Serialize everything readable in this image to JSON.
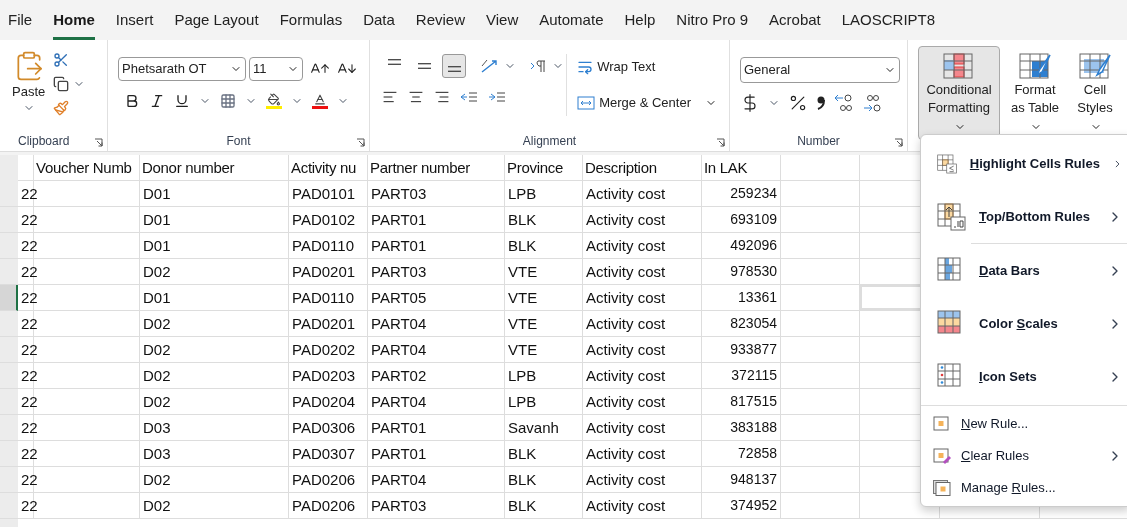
{
  "tabs": [
    {
      "label": "File",
      "selected": false
    },
    {
      "label": "Home",
      "selected": true
    },
    {
      "label": "Insert",
      "selected": false
    },
    {
      "label": "Page Layout",
      "selected": false
    },
    {
      "label": "Formulas",
      "selected": false
    },
    {
      "label": "Data",
      "selected": false
    },
    {
      "label": "Review",
      "selected": false
    },
    {
      "label": "View",
      "selected": false
    },
    {
      "label": "Automate",
      "selected": false
    },
    {
      "label": "Help",
      "selected": false
    },
    {
      "label": "Nitro Pro 9",
      "selected": false
    },
    {
      "label": "Acrobat",
      "selected": false
    },
    {
      "label": "LAOSCRIPT8",
      "selected": false
    }
  ],
  "ribbon": {
    "clipboard": {
      "label": "Clipboard",
      "paste": "Paste"
    },
    "font": {
      "label": "Font",
      "font_name": "Phetsarath OT",
      "font_size": "11"
    },
    "alignment": {
      "label": "Alignment",
      "wrap_text": "Wrap Text",
      "merge": "Merge & Center",
      "vertical_align": [
        {
          "selected": false
        },
        {
          "selected": false
        },
        {
          "selected": true
        }
      ]
    },
    "number": {
      "label": "Number",
      "format": "General"
    },
    "styles": [
      {
        "label": "Conditional Formatting",
        "selected": true
      },
      {
        "label": "Format as Table",
        "selected": false
      },
      {
        "label": "Cell Styles",
        "selected": false
      }
    ]
  },
  "sheet": {
    "columns": [
      "",
      "Voucher Numb",
      "Donor number",
      "Activity nu",
      "Partner number",
      "Province",
      "Description",
      "In LAK"
    ],
    "rows": [
      {
        "cells": [
          "22",
          "",
          "D01",
          "PAD0101",
          "PART03",
          "LPB",
          "Activity cost",
          "259234"
        ],
        "selected": false
      },
      {
        "cells": [
          "22",
          "",
          "D01",
          "PAD0102",
          "PART01",
          "BLK",
          "Activity cost",
          "693109"
        ],
        "selected": false
      },
      {
        "cells": [
          "22",
          "",
          "D01",
          "PAD0110",
          "PART01",
          "BLK",
          "Activity cost",
          "492096"
        ],
        "selected": false
      },
      {
        "cells": [
          "22",
          "",
          "D02",
          "PAD0201",
          "PART03",
          "VTE",
          "Activity cost",
          "978530"
        ],
        "selected": false
      },
      {
        "cells": [
          "22",
          "",
          "D01",
          "PAD0110",
          "PART05",
          "VTE",
          "Activity cost",
          "13361"
        ],
        "selected": true
      },
      {
        "cells": [
          "22",
          "",
          "D02",
          "PAD0201",
          "PART04",
          "VTE",
          "Activity cost",
          "823054"
        ],
        "selected": false
      },
      {
        "cells": [
          "22",
          "",
          "D02",
          "PAD0202",
          "PART04",
          "VTE",
          "Activity cost",
          "933877"
        ],
        "selected": false
      },
      {
        "cells": [
          "22",
          "",
          "D02",
          "PAD0203",
          "PART02",
          "LPB",
          "Activity cost",
          "372115"
        ],
        "selected": false
      },
      {
        "cells": [
          "22",
          "",
          "D02",
          "PAD0204",
          "PART04",
          "LPB",
          "Activity cost",
          "817515"
        ],
        "selected": false
      },
      {
        "cells": [
          "22",
          "",
          "D03",
          "PAD0306",
          "PART01",
          "Savanh",
          "Activity cost",
          "383188"
        ],
        "selected": false
      },
      {
        "cells": [
          "22",
          "",
          "D03",
          "PAD0307",
          "PART01",
          "BLK",
          "Activity cost",
          "72858"
        ],
        "selected": false
      },
      {
        "cells": [
          "22",
          "",
          "D02",
          "PAD0206",
          "PART04",
          "BLK",
          "Activity cost",
          "948137"
        ],
        "selected": false
      },
      {
        "cells": [
          "22",
          "",
          "D02",
          "PAD0206",
          "PART03",
          "BLK",
          "Activity cost",
          "374952"
        ],
        "selected": false
      }
    ]
  },
  "menu": {
    "main_items": [
      {
        "key": "H",
        "post": "ighlight Cells Rules",
        "submenu": true
      },
      {
        "key": "T",
        "post": "op/Bottom Rules",
        "submenu": true
      },
      {
        "key": "D",
        "post": "ata Bars",
        "submenu": true
      },
      {
        "pre": "Color ",
        "key": "S",
        "post": "cales",
        "submenu": true
      },
      {
        "key": "I",
        "post": "con Sets",
        "submenu": true
      }
    ],
    "rule_items": [
      {
        "key": "N",
        "post": "ew Rule...",
        "submenu": false
      },
      {
        "key": "C",
        "post": "lear Rules",
        "submenu": true
      },
      {
        "pre": "Manage ",
        "key": "R",
        "post": "ules...",
        "submenu": false
      }
    ]
  }
}
